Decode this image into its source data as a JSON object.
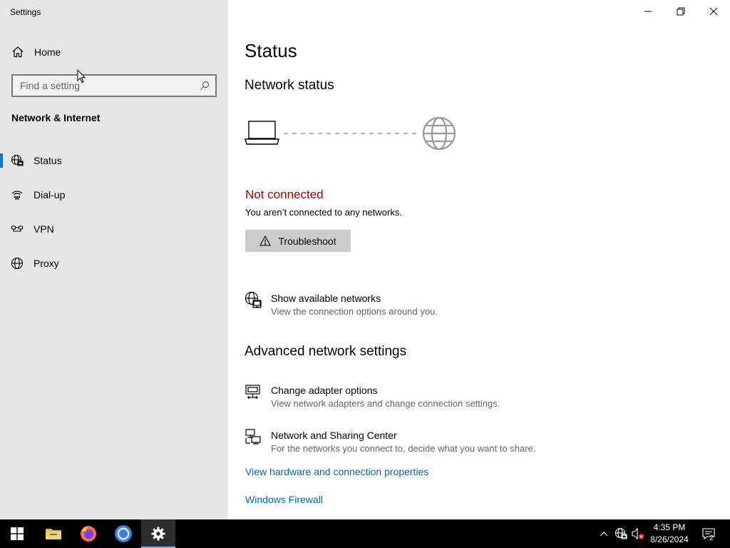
{
  "window": {
    "title": "Settings",
    "controls": {
      "minimize_icon": "minimize-icon",
      "restore_icon": "restore-icon",
      "close_icon": "close-icon"
    }
  },
  "sidebar": {
    "home_label": "Home",
    "search_placeholder": "Find a setting",
    "section_title": "Network & Internet",
    "items": [
      {
        "label": "Status",
        "icon": "status-globe-icon",
        "active": true
      },
      {
        "label": "Dial-up",
        "icon": "dialup-icon",
        "active": false
      },
      {
        "label": "VPN",
        "icon": "vpn-icon",
        "active": false
      },
      {
        "label": "Proxy",
        "icon": "globe-icon",
        "active": false
      }
    ]
  },
  "main": {
    "page_title": "Status",
    "network_status_heading": "Network status",
    "connection_state": "Not connected",
    "connection_detail": "You aren’t connected to any networks.",
    "troubleshoot_label": "Troubleshoot",
    "show_networks": {
      "title": "Show available networks",
      "subtitle": "View the connection options around you."
    },
    "advanced_heading": "Advanced network settings",
    "adapter_options": {
      "title": "Change adapter options",
      "subtitle": "View network adapters and change connection settings."
    },
    "sharing_center": {
      "title": "Network and Sharing Center",
      "subtitle": "For the networks you connect to, decide what you want to share."
    },
    "links": {
      "hardware_properties": "View hardware and connection properties",
      "firewall": "Windows Firewall"
    }
  },
  "taskbar": {
    "apps": [
      "start-icon",
      "file-explorer-icon",
      "firefox-icon",
      "chrome-icon",
      "settings-icon"
    ],
    "clock_time": "4:35 PM",
    "clock_date": "8/26/2024",
    "notification_count": "2"
  },
  "colors": {
    "sidebar_bg": "#e6e6e6",
    "accent": "#0078d7",
    "error": "#a80000",
    "link": "#0066b4",
    "taskbar_bg": "#000000"
  }
}
